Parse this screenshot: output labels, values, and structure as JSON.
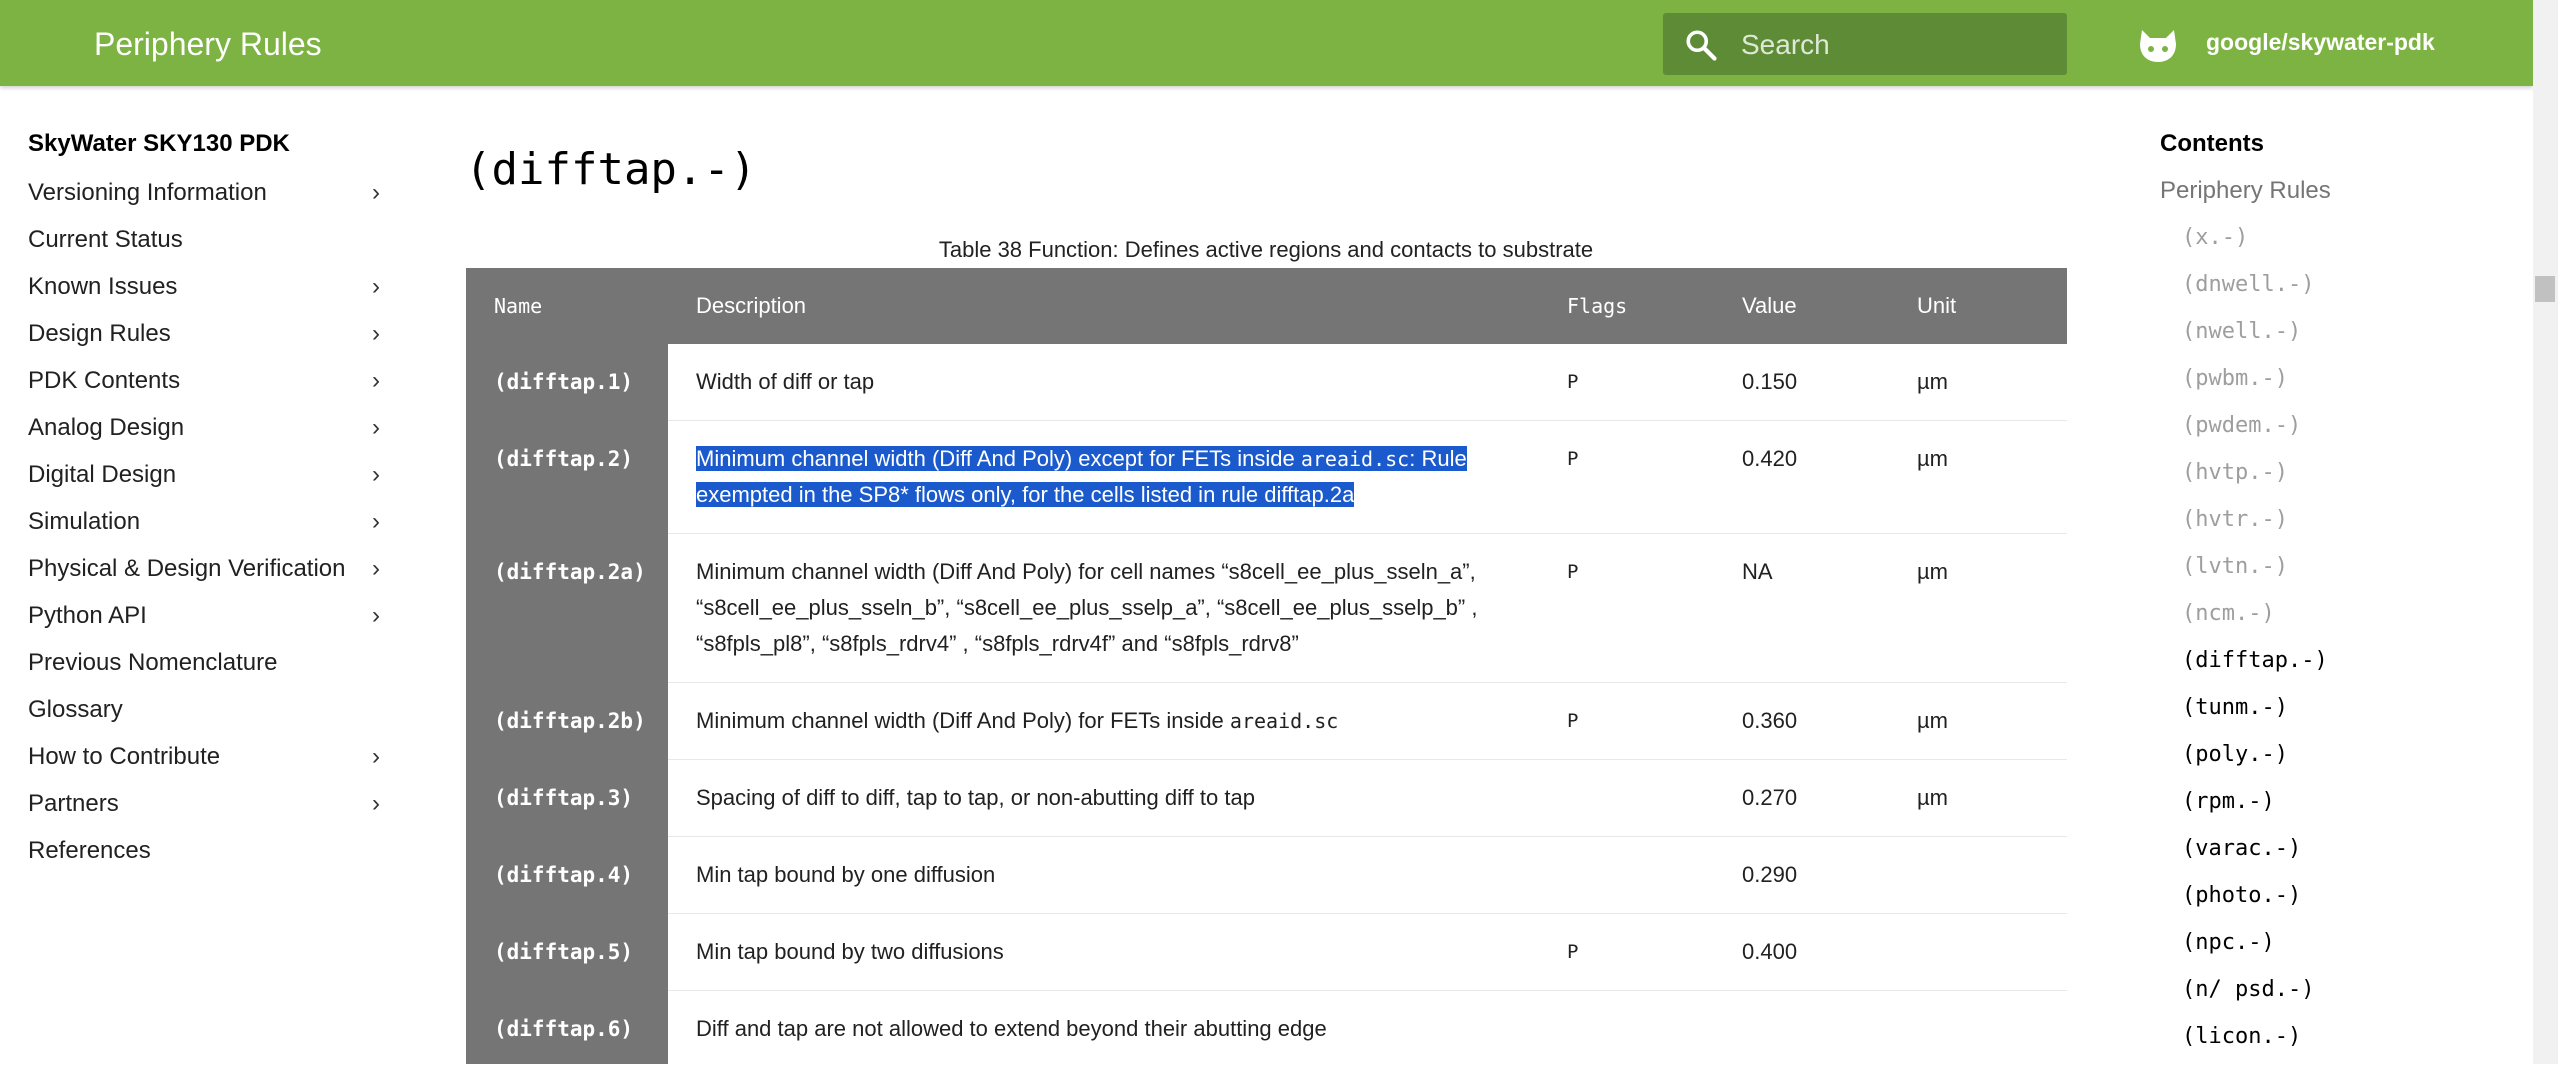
{
  "header": {
    "title": "Periphery Rules",
    "search_placeholder": "Search",
    "repo": "google/skywater-pdk",
    "color": "#7cb342"
  },
  "nav": {
    "site_title": "SkyWater SKY130 PDK",
    "items": [
      {
        "label": "Versioning Information",
        "expandable": true
      },
      {
        "label": "Current Status",
        "expandable": false
      },
      {
        "label": "Known Issues",
        "expandable": true
      },
      {
        "label": "Design Rules",
        "expandable": true
      },
      {
        "label": "PDK Contents",
        "expandable": true
      },
      {
        "label": "Analog Design",
        "expandable": true
      },
      {
        "label": "Digital Design",
        "expandable": true
      },
      {
        "label": "Simulation",
        "expandable": true
      },
      {
        "label": "Physical & Design Verification",
        "expandable": true
      },
      {
        "label": "Python API",
        "expandable": true
      },
      {
        "label": "Previous Nomenclature",
        "expandable": false
      },
      {
        "label": "Glossary",
        "expandable": false
      },
      {
        "label": "How to Contribute",
        "expandable": true
      },
      {
        "label": "Partners",
        "expandable": true
      },
      {
        "label": "References",
        "expandable": false
      }
    ],
    "chevron": "›"
  },
  "main": {
    "title": "(difftap.-)",
    "caption": "Table 38 Function: Defines active regions and contacts to substrate",
    "columns": {
      "name": "Name",
      "description": "Description",
      "flags": "Flags",
      "value": "Value",
      "unit": "Unit"
    },
    "rows": [
      {
        "name": "(difftap.1)",
        "desc": "Width of diff or tap",
        "flags": "P",
        "value": "0.150",
        "unit": "µm"
      },
      {
        "name": "(difftap.2)",
        "desc_before": "Minimum channel width (Diff And Poly) except for FETs inside ",
        "desc_code": "areaid.sc",
        "desc_after": ": Rule exempted in the SP8* flows only, for the cells listed in rule difftap.2a",
        "flags": "P",
        "value": "0.420",
        "unit": "µm"
      },
      {
        "name": "(difftap.2a)",
        "desc": "Minimum channel width (Diff And Poly) for cell names “s8cell_ee_plus_sseln_a”, “s8cell_ee_plus_sseln_b”, “s8cell_ee_plus_sselp_a”, “s8cell_ee_plus_sselp_b” , “s8fpls_pl8”, “s8fpls_rdrv4” , “s8fpls_rdrv4f” and “s8fpls_rdrv8”",
        "flags": "P",
        "value": "NA",
        "unit": "µm"
      },
      {
        "name": "(difftap.2b)",
        "desc_before": "Minimum channel width (Diff And Poly) for FETs inside ",
        "desc_code": "areaid.sc",
        "flags": "P",
        "value": "0.360",
        "unit": "µm"
      },
      {
        "name": "(difftap.3)",
        "desc": "Spacing of diff to diff, tap to tap, or non-abutting diff to tap",
        "flags": "",
        "value": "0.270",
        "unit": "µm"
      },
      {
        "name": "(difftap.4)",
        "desc": "Min tap bound by one diffusion",
        "flags": "",
        "value": "0.290",
        "unit": ""
      },
      {
        "name": "(difftap.5)",
        "desc": "Min tap bound by two diffusions",
        "flags": "P",
        "value": "0.400",
        "unit": ""
      },
      {
        "name": "(difftap.6)",
        "desc": "Diff and tap are not allowed to extend beyond their abutting edge",
        "flags": "",
        "value": "",
        "unit": ""
      }
    ],
    "highlight_color": "#1a5acc"
  },
  "toc": {
    "heading": "Contents",
    "section": "Periphery Rules",
    "items": [
      {
        "label": "(x.-)",
        "current": false
      },
      {
        "label": "(dnwell.-)",
        "current": false
      },
      {
        "label": "(nwell.-)",
        "current": false
      },
      {
        "label": "(pwbm.-)",
        "current": false
      },
      {
        "label": "(pwdem.-)",
        "current": false
      },
      {
        "label": "(hvtp.-)",
        "current": false
      },
      {
        "label": "(hvtr.-)",
        "current": false
      },
      {
        "label": "(lvtn.-)",
        "current": false
      },
      {
        "label": "(ncm.-)",
        "current": false
      },
      {
        "label": "(difftap.-)",
        "current": true
      },
      {
        "label": "(tunm.-)",
        "current": true
      },
      {
        "label": "(poly.-)",
        "current": true
      },
      {
        "label": "(rpm.-)",
        "current": true
      },
      {
        "label": "(varac.-)",
        "current": true
      },
      {
        "label": "(photo.-)",
        "current": true
      },
      {
        "label": "(npc.-)",
        "current": true
      },
      {
        "label": "(n/ psd.-)",
        "current": true
      },
      {
        "label": "(licon.-)",
        "current": true
      }
    ]
  }
}
